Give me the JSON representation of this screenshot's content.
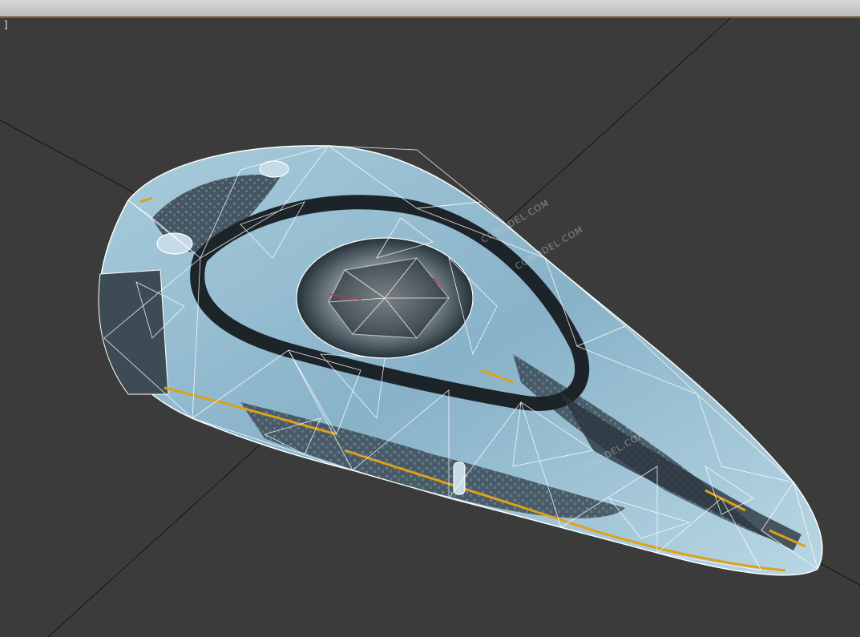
{
  "viewport": {
    "label": "]",
    "background": "#3b3b3b"
  },
  "model": {
    "body_color": "#8fb7cc",
    "dark_panel_color": "#2d3a44",
    "wire_color": "#ffffff",
    "accent_color": "#e0a019"
  },
  "watermarks": [
    "CGMODEL.COM",
    "CGMODEL.COM",
    "CGMODEL.COM"
  ]
}
